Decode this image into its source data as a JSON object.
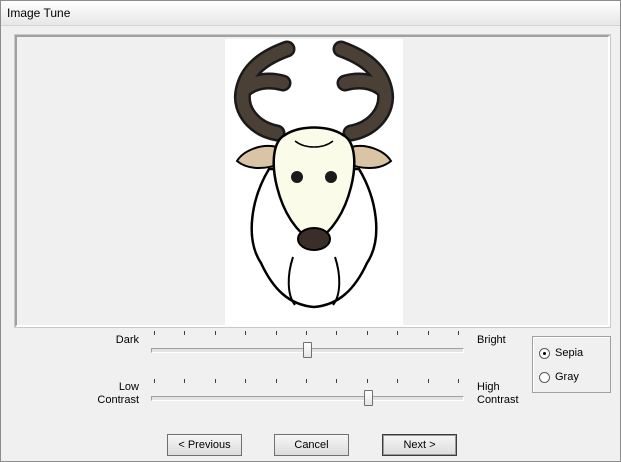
{
  "window": {
    "title": "Image Tune"
  },
  "brightness": {
    "left_label": "Dark",
    "right_label": "Bright",
    "value_fraction": 0.5,
    "tick_count": 11
  },
  "contrast": {
    "left_label_line1": "Low",
    "left_label_line2": "Contrast",
    "right_label_line1": "High",
    "right_label_line2": "Contrast",
    "value_fraction": 0.7,
    "tick_count": 11
  },
  "color_mode": {
    "options": [
      {
        "label": "Sepia",
        "selected": true
      },
      {
        "label": "Gray",
        "selected": false
      }
    ]
  },
  "buttons": {
    "previous": "< Previous",
    "cancel": "Cancel",
    "next": "Next >"
  },
  "colors": {
    "antlers": "#4a4036",
    "ears": "#d9c4a6",
    "face": "#fbfbe9",
    "nose": "#3a2e28"
  }
}
